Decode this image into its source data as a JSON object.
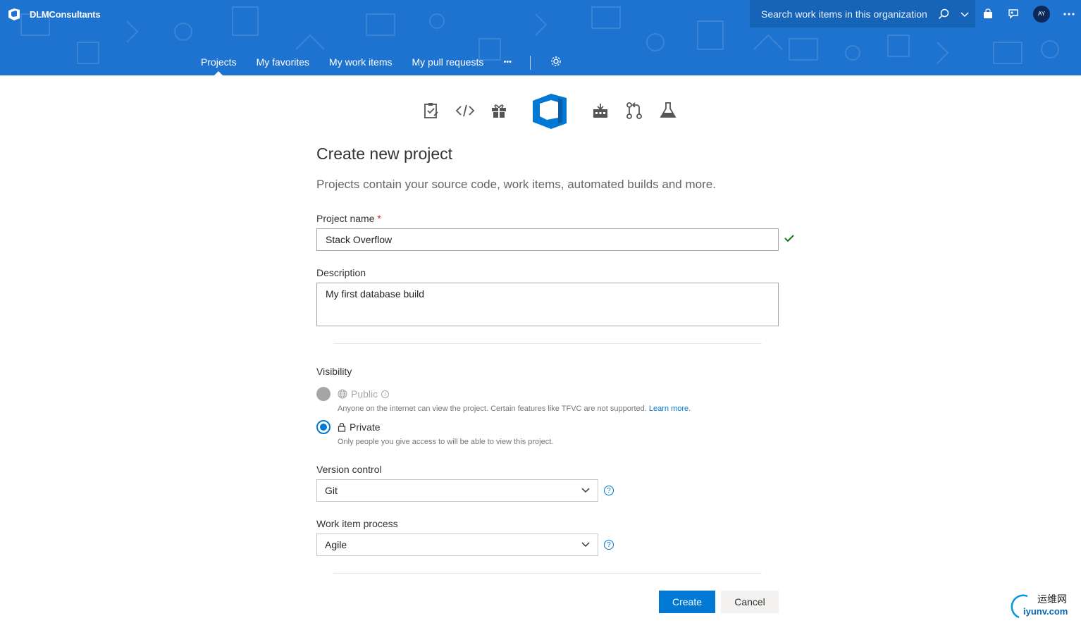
{
  "app": {
    "org_name": "DLMConsultants",
    "accent_color": "#1f73d0",
    "primary_button_color": "#0078d4"
  },
  "header": {
    "search_placeholder": "Search work items in this organization",
    "avatar_initials": "AY",
    "icons": [
      "search-icon",
      "chevron-down-icon",
      "shopping-bag-icon",
      "feedback-icon",
      "avatar",
      "more-icon"
    ]
  },
  "nav": {
    "items": [
      {
        "label": "Projects",
        "active": true
      },
      {
        "label": "My favorites",
        "active": false
      },
      {
        "label": "My work items",
        "active": false
      },
      {
        "label": "My pull requests",
        "active": false
      }
    ],
    "more_label": "•••"
  },
  "services": [
    "boards-icon",
    "repos-icon",
    "artifacts-icon",
    "azure-devops-logo",
    "pipelines-icon",
    "pull-request-icon",
    "test-plans-icon"
  ],
  "form": {
    "title": "Create new project",
    "subtitle": "Projects contain your source code, work items, automated builds and more.",
    "project_name": {
      "label": "Project name",
      "required_mark": "*",
      "value": "Stack Overflow",
      "valid": true
    },
    "description": {
      "label": "Description",
      "value": "My first database build"
    },
    "visibility": {
      "label": "Visibility",
      "options": [
        {
          "label": "Public",
          "description": "Anyone on the internet can view the project. Certain features like TFVC are not supported.",
          "link": "Learn more.",
          "enabled": false,
          "selected": false
        },
        {
          "label": "Private",
          "description": "Only people you give access to will be able to view this project.",
          "enabled": true,
          "selected": true
        }
      ]
    },
    "version_control": {
      "label": "Version control",
      "value": "Git"
    },
    "work_item_process": {
      "label": "Work item process",
      "value": "Agile"
    },
    "create_label": "Create",
    "cancel_label": "Cancel"
  },
  "watermark": {
    "line1": "运维网",
    "line2": "iyunv.com"
  }
}
